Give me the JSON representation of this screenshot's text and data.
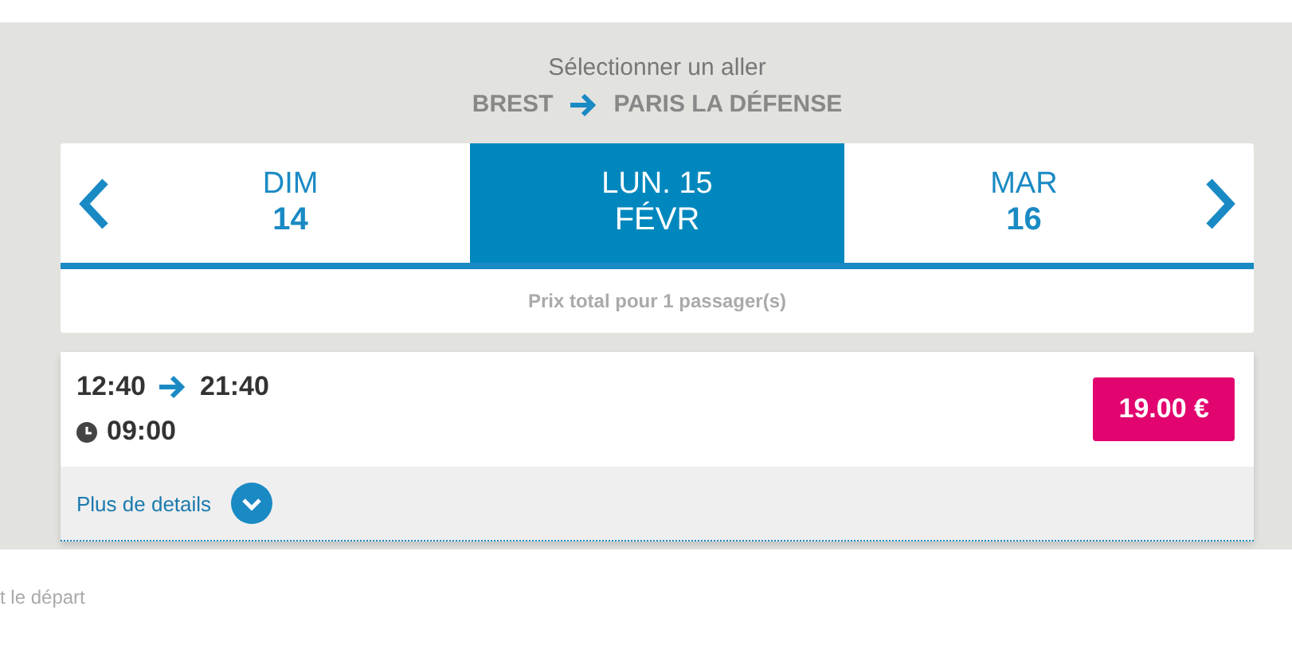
{
  "header": {
    "title": "Sélectionner un aller",
    "origin": "BREST",
    "destination": "PARIS LA DÉFENSE"
  },
  "days": [
    {
      "line1": "DIM",
      "line2": "14",
      "selected": false
    },
    {
      "line1": "LUN. 15",
      "line2": "FÉVR",
      "selected": true
    },
    {
      "line1": "MAR",
      "line2": "16",
      "selected": false
    }
  ],
  "price_note": "Prix total pour 1 passager(s)",
  "journey": {
    "departure": "12:40",
    "arrival": "21:40",
    "duration": "09:00",
    "price": "19.00 €",
    "details_link": "Plus de details"
  },
  "footer_text": "t le départ"
}
